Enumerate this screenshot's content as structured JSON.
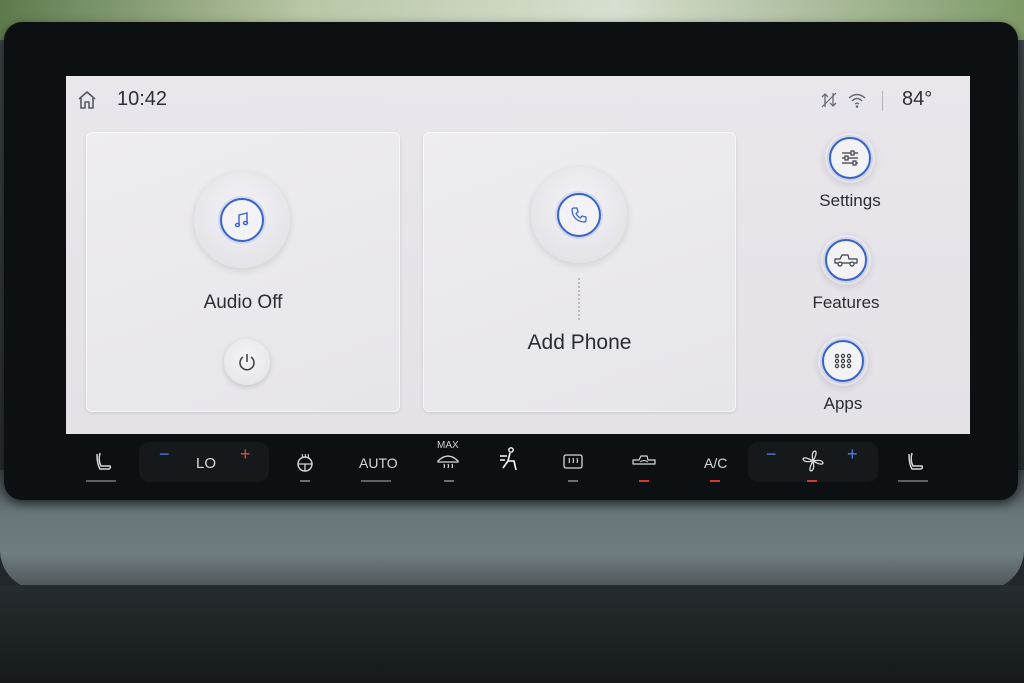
{
  "status_bar": {
    "time": "10:42",
    "temperature": "84°",
    "icons": [
      "home-icon",
      "data-transfer-icon",
      "wifi-icon"
    ]
  },
  "audio_card": {
    "label": "Audio Off",
    "icons": [
      "music-note-icon",
      "power-icon"
    ]
  },
  "phone_card": {
    "label": "Add Phone",
    "icons": [
      "phone-icon"
    ]
  },
  "side_menu": {
    "items": [
      {
        "label": "Settings",
        "icon": "sliders-icon"
      },
      {
        "label": "Features",
        "icon": "truck-icon"
      },
      {
        "label": "Apps",
        "icon": "apps-grid-icon"
      }
    ]
  },
  "climate": {
    "driver_temp": "LO",
    "auto_label": "AUTO",
    "max_label": "MAX",
    "ac_label": "A/C",
    "icons": [
      "seat-heat-left-icon",
      "heated-wheel-icon",
      "max-defrost-icon",
      "air-direction-icon",
      "rear-defrost-icon",
      "recirculation-icon",
      "fan-icon",
      "seat-heat-right-icon"
    ]
  },
  "colors": {
    "accent_blue": "#3a63c8",
    "indicator_red": "#d23a2c",
    "screen_bg": "#e7e5ea"
  }
}
